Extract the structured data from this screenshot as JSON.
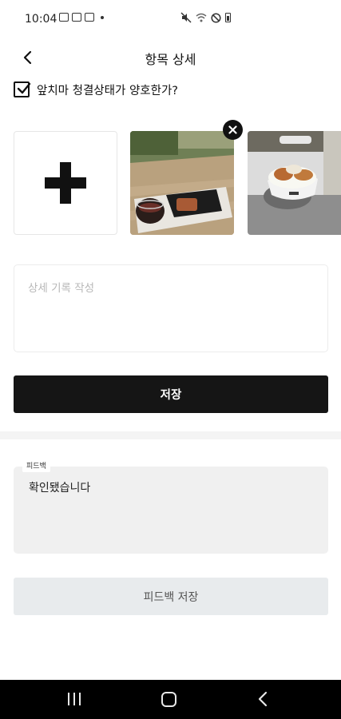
{
  "status_bar": {
    "time": "10:04"
  },
  "header": {
    "title": "항목 상세"
  },
  "checklist_item": {
    "label": "앞치마 청결상태가 양호한가?",
    "checked": true
  },
  "photos": [
    {
      "description_icon": "photo-thumbnail",
      "has_remove": true
    },
    {
      "description_icon": "photo-thumbnail",
      "has_remove": false
    }
  ],
  "detail": {
    "placeholder": "상세 기록 작성"
  },
  "save_button": {
    "label": "저장"
  },
  "feedback": {
    "legend": "피드백",
    "text": "확인됐습니다"
  },
  "feedback_save_button": {
    "label": "피드백 저장"
  },
  "colors": {
    "primary_button": "#151515",
    "disabled_button": "#e8ebed",
    "feedback_bg": "#f0f0f0"
  }
}
